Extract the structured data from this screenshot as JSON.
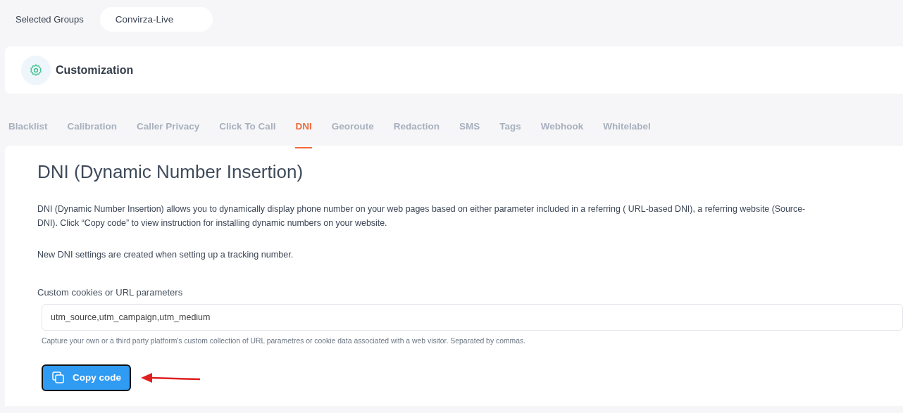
{
  "selected_groups": {
    "label": "Selected Groups",
    "value": "Convirza-Live"
  },
  "header": {
    "title": "Customization"
  },
  "tabs": [
    {
      "label": "Blacklist",
      "selected": false
    },
    {
      "label": "Calibration",
      "selected": false
    },
    {
      "label": "Caller Privacy",
      "selected": false
    },
    {
      "label": "Click To Call",
      "selected": false
    },
    {
      "label": "DNI",
      "selected": true
    },
    {
      "label": "Georoute",
      "selected": false
    },
    {
      "label": "Redaction",
      "selected": false
    },
    {
      "label": "SMS",
      "selected": false
    },
    {
      "label": "Tags",
      "selected": false
    },
    {
      "label": "Webhook",
      "selected": false
    },
    {
      "label": "Whitelabel",
      "selected": false
    }
  ],
  "panel": {
    "title": "DNI (Dynamic Number Insertion)",
    "description_lines": [
      "DNI (Dynamic Number Insertion) allows you to dynamically display phone number on your web pages based on either parameter included in a referring ( URL-based DNI), a referring website (Source-",
      "DNI). Click “Copy code” to view instruction for installing dynamic numbers on your website."
    ],
    "note": "New DNI settings are created when setting up a tracking number.",
    "field": {
      "label": "Custom cookies or URL parameters",
      "value": "utm_source,utm_campaign,utm_medium",
      "help": "Capture your own or a third party platform's custom collection of URL parametres or cookie data associated with a web visitor. Separated by commas."
    },
    "button": {
      "label": "Copy code"
    }
  }
}
